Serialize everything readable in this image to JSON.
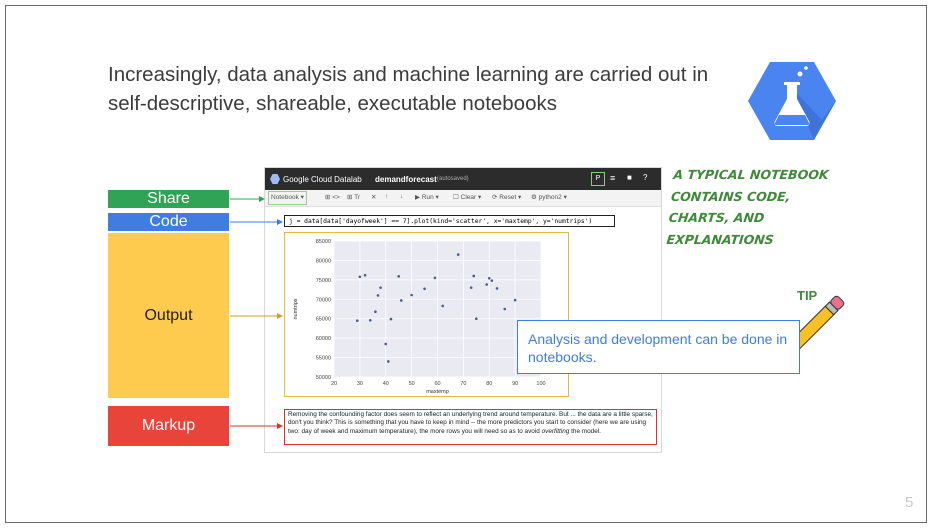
{
  "slide": {
    "title": "Increasingly, data analysis and machine learning are carried out in self-descriptive, shareable, executable notebooks",
    "page_number": "5"
  },
  "labels": {
    "share": "Share",
    "code": "Code",
    "output": "Output",
    "markup": "Markup"
  },
  "notebook": {
    "brand": "Google Cloud Datalab",
    "notebook_name": "demandforecast",
    "autosave": "(autosaved)",
    "toolbar": {
      "notebook": "Notebook",
      "add_text": "Tr",
      "run": "Run",
      "clear": "Clear",
      "reset": "Reset",
      "kernel": "python2"
    },
    "code_line": "j = data[data['dayofweek'] == 7].plot(kind='scatter', x='maxtemp', y='numtrips')",
    "markup_text_1": "Removing the confounding factor does seem to reflect an underlying trend around temperature. But ... the data are a little sparse, don't you think? This is something that you have to keep in mind -- the more predictors you start to consider (here we are using two: day of week and maximum temperature), the more rows you will need so as to avoid ",
    "markup_em": "overfitting",
    "markup_text_2": " the model."
  },
  "note": {
    "green": "A typical notebook contains code, charts, and explanations",
    "tip_label": "TIP",
    "tip_text": "Analysis and development can be done in notebooks."
  },
  "colors": {
    "share": "#31a354",
    "code": "#3f7de0",
    "output": "#fecb4e",
    "markup": "#e9443a",
    "note_green": "#3f8a3a"
  },
  "chart_data": {
    "type": "scatter",
    "xlabel": "maxtemp",
    "ylabel": "numtrips",
    "xlim": [
      20,
      100
    ],
    "ylim": [
      50000,
      85000
    ],
    "x_ticks": [
      20,
      30,
      40,
      50,
      60,
      70,
      80,
      90,
      100
    ],
    "y_ticks": [
      50000,
      55000,
      60000,
      65000,
      70000,
      75000,
      80000,
      85000
    ],
    "grid": true,
    "points": [
      [
        29,
        64500
      ],
      [
        30,
        75800
      ],
      [
        32,
        76200
      ],
      [
        34,
        64600
      ],
      [
        36,
        66800
      ],
      [
        37,
        71000
      ],
      [
        38,
        73000
      ],
      [
        40,
        58500
      ],
      [
        41,
        54000
      ],
      [
        42,
        64900
      ],
      [
        45,
        75900
      ],
      [
        46,
        69700
      ],
      [
        50,
        71100
      ],
      [
        55,
        72700
      ],
      [
        59,
        75500
      ],
      [
        62,
        68300
      ],
      [
        68,
        81500
      ],
      [
        73,
        73000
      ],
      [
        74,
        76000
      ],
      [
        75,
        65000
      ],
      [
        79,
        73800
      ],
      [
        80,
        75400
      ],
      [
        81,
        74800
      ],
      [
        83,
        72800
      ],
      [
        86,
        67500
      ],
      [
        90,
        69800
      ]
    ]
  }
}
